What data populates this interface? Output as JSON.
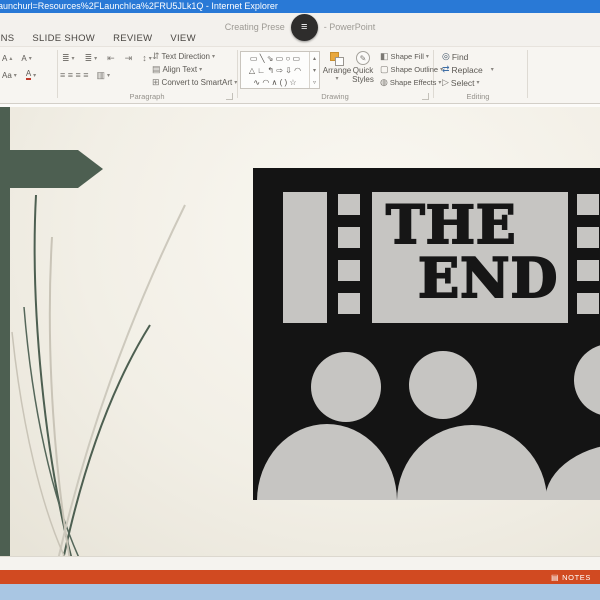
{
  "window": {
    "title": "aunchurl=Resources%2FLaunchIca%2FRU5JLk1Q - Internet Explorer"
  },
  "app_header": {
    "doc_title_left": "Creating Prese",
    "doc_title_right": "- PowerPoint",
    "menu_badge_icon": "hamburger-icon",
    "menu_badge_glyph": "≡"
  },
  "ribbon": {
    "tabs": [
      {
        "label": "ANIMATIONS",
        "clipped": true
      },
      {
        "label": "SLIDE SHOW"
      },
      {
        "label": "REVIEW"
      },
      {
        "label": "VIEW"
      }
    ],
    "font_group": {
      "grow_font": "A",
      "grow_arrow": "▴",
      "shrink_font": "A",
      "shrink_arrow": "▾",
      "change_case": "Aa",
      "font_color": "A",
      "dropdown": "▾"
    },
    "paragraph": {
      "label": "Paragraph",
      "bullets_icon": "≣",
      "numbering_icon": "≣",
      "indent_dec_icon": "⇤",
      "indent_inc_icon": "⇥",
      "line_spacing_icon": "↕",
      "align_icons": "≡ ≡ ≡ ≡",
      "columns_icon": "▥",
      "text_direction": "Text Direction",
      "align_text": "Align Text",
      "convert_smartart": "Convert to SmartArt"
    },
    "drawing": {
      "label": "Drawing",
      "shape_rows": [
        "▭ ╲ ⇘ ▭ ○ ▭",
        "△ ∟ ↰ ⇨ ⇩ ◠",
        "∿ ◠ ∧ ( ) ☆"
      ],
      "scroll_up": "▴",
      "scroll_down": "▾",
      "scroll_more": "▿",
      "arrange": "Arrange",
      "quick_styles": "Quick Styles",
      "shape_fill": "Shape Fill",
      "shape_outline": "Shape Outline",
      "shape_effects": "Shape Effects",
      "fill_icon": "◧",
      "outline_icon": "▢",
      "effects_icon": "◍",
      "dropdown": "▾"
    },
    "editing": {
      "label": "Editing",
      "find": "Find",
      "replace": "Replace",
      "select": "Select",
      "find_icon": "◎",
      "replace_icon": "⇄",
      "select_icon": "▷",
      "dropdown": "▾"
    }
  },
  "slide": {
    "clipart_text_line1": "THE",
    "clipart_text_line2": "END",
    "theme": "cross-and-grass"
  },
  "status_bar": {
    "notes": "NOTES",
    "notes_icon": "▤"
  },
  "colors": {
    "titlebar_blue": "#2979d6",
    "chrome_bg": "#f3f1ed",
    "slide_cream": "#f2efe6",
    "cross_green": "#4d5f51",
    "grass_gray": "#c9c4b7",
    "clipart_black": "#141414",
    "clipart_gray": "#c6c5c2",
    "status_orange": "#d14a21",
    "bottom_blue": "#a9c6e3"
  }
}
